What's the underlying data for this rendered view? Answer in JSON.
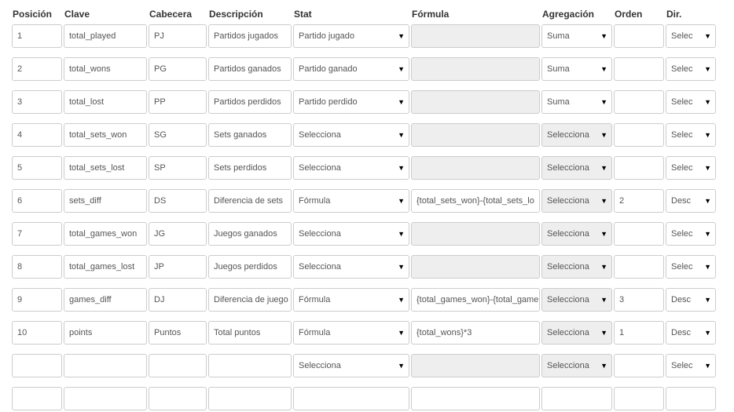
{
  "headers": {
    "posicion": "Posición",
    "clave": "Clave",
    "cabecera": "Cabecera",
    "descripcion": "Descripción",
    "stat": "Stat",
    "formula": "Fórmula",
    "agregacion": "Agregación",
    "orden": "Orden",
    "dir": "Dir."
  },
  "rows": [
    {
      "pos": "1",
      "clave": "total_played",
      "cab": "PJ",
      "desc": "Partidos jugados",
      "stat": "Partido jugado",
      "formula": "",
      "agg": "Suma",
      "orden": "",
      "dir": "Selec"
    },
    {
      "pos": "2",
      "clave": "total_wons",
      "cab": "PG",
      "desc": "Partidos ganados",
      "stat": "Partido ganado",
      "formula": "",
      "agg": "Suma",
      "orden": "",
      "dir": "Selec"
    },
    {
      "pos": "3",
      "clave": "total_lost",
      "cab": "PP",
      "desc": "Partidos perdidos",
      "stat": "Partido perdido",
      "formula": "",
      "agg": "Suma",
      "orden": "",
      "dir": "Selec"
    },
    {
      "pos": "4",
      "clave": "total_sets_won",
      "cab": "SG",
      "desc": "Sets ganados",
      "stat": "Selecciona",
      "formula": "",
      "agg": "Selecciona",
      "orden": "",
      "dir": "Selec"
    },
    {
      "pos": "5",
      "clave": "total_sets_lost",
      "cab": "SP",
      "desc": "Sets perdidos",
      "stat": "Selecciona",
      "formula": "",
      "agg": "Selecciona",
      "orden": "",
      "dir": "Selec"
    },
    {
      "pos": "6",
      "clave": "sets_diff",
      "cab": "DS",
      "desc": "Diferencia de sets",
      "stat": "Fórmula",
      "formula": "{total_sets_won}-{total_sets_lo",
      "agg": "Selecciona",
      "orden": "2",
      "dir": "Desc"
    },
    {
      "pos": "7",
      "clave": "total_games_won",
      "cab": "JG",
      "desc": "Juegos ganados",
      "stat": "Selecciona",
      "formula": "",
      "agg": "Selecciona",
      "orden": "",
      "dir": "Selec"
    },
    {
      "pos": "8",
      "clave": "total_games_lost",
      "cab": "JP",
      "desc": "Juegos perdidos",
      "stat": "Selecciona",
      "formula": "",
      "agg": "Selecciona",
      "orden": "",
      "dir": "Selec"
    },
    {
      "pos": "9",
      "clave": "games_diff",
      "cab": "DJ",
      "desc": "Diferencia de juego",
      "stat": "Fórmula",
      "formula": "{total_games_won}-{total_game",
      "agg": "Selecciona",
      "orden": "3",
      "dir": "Desc"
    },
    {
      "pos": "10",
      "clave": "points",
      "cab": "Puntos",
      "desc": "Total puntos",
      "stat": "Fórmula",
      "formula": "{total_wons}*3",
      "agg": "Selecciona",
      "orden": "1",
      "dir": "Desc"
    },
    {
      "pos": "",
      "clave": "",
      "cab": "",
      "desc": "",
      "stat": "Selecciona",
      "formula": "",
      "agg": "Selecciona",
      "orden": "",
      "dir": "Selec"
    }
  ],
  "icons": {
    "select_arrow": "triangle-down-icon"
  }
}
